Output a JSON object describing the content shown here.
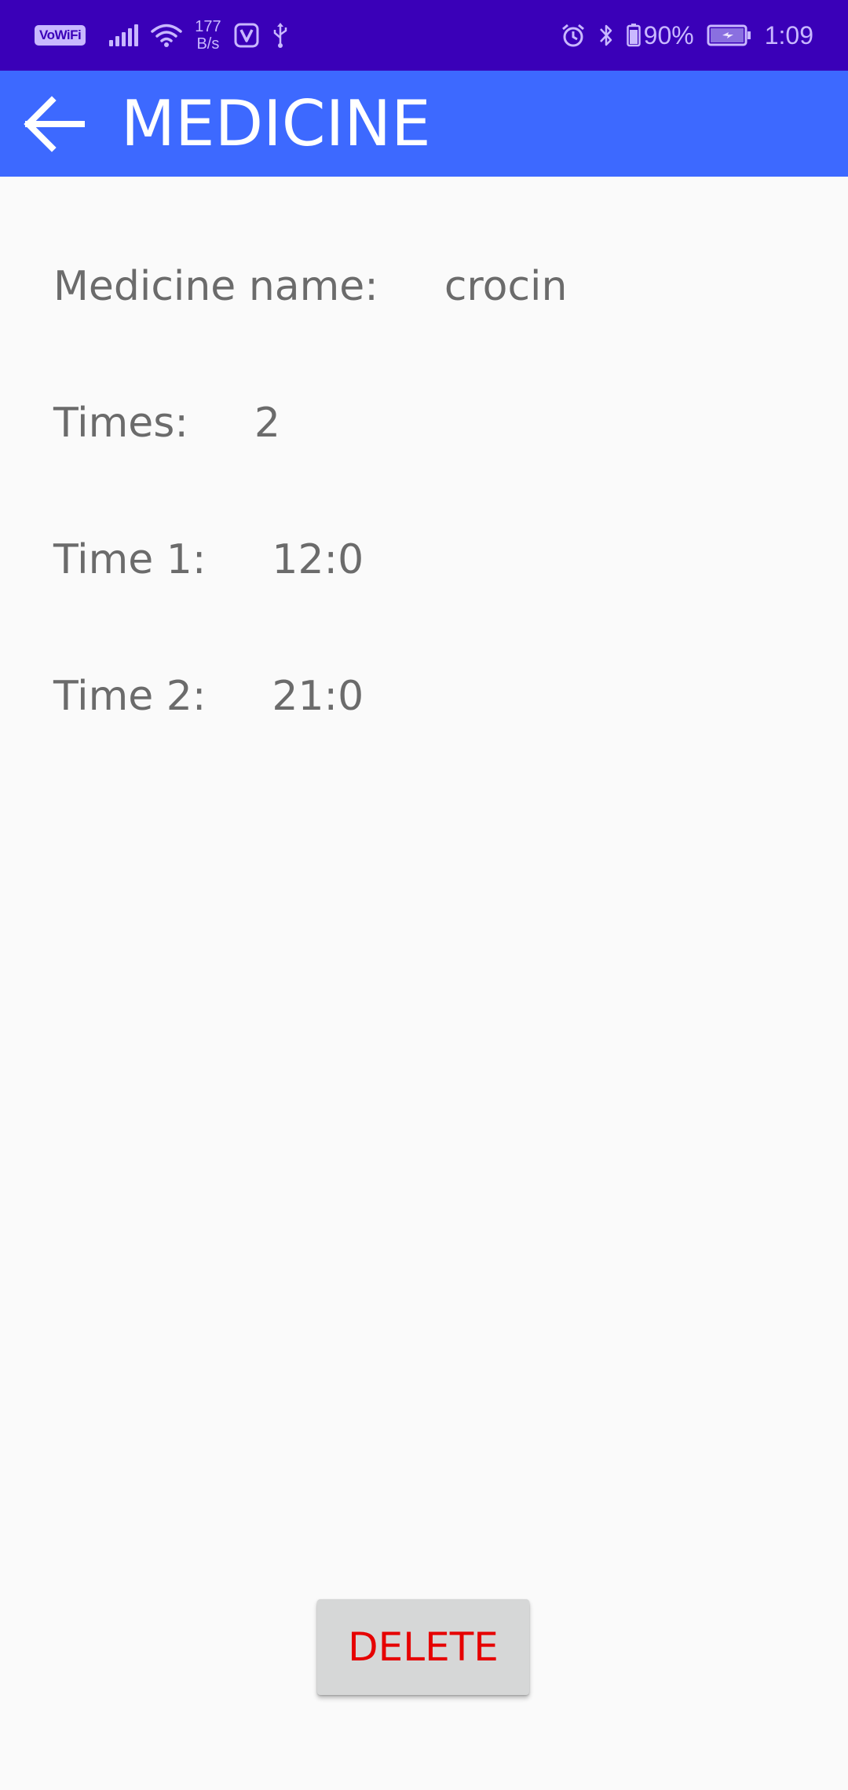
{
  "status_bar": {
    "vowifi_label": "VoWiFi",
    "net_speed_value": "177",
    "net_speed_unit": "B/s",
    "battery_percent": "90%",
    "time": "1:09",
    "icons": [
      "vowifi-icon",
      "signal-icon",
      "wifi-icon",
      "app-icon",
      "usb-icon",
      "alarm-icon",
      "bluetooth-icon",
      "battery-icon",
      "charging-battery-icon"
    ],
    "background": "#3a00b8"
  },
  "app_bar": {
    "title": "MEDICINE",
    "back_icon": "arrow-back-icon",
    "background": "#3d69ff"
  },
  "details": {
    "name_label": "Medicine name:",
    "name_value": "crocin",
    "times_label": "Times:",
    "times_value": "2",
    "time1_label": "Time 1:",
    "time1_value": "12:0",
    "time2_label": "Time 2:",
    "time2_value": "21:0"
  },
  "actions": {
    "delete_label": "DELETE",
    "delete_color": "#e60000"
  }
}
